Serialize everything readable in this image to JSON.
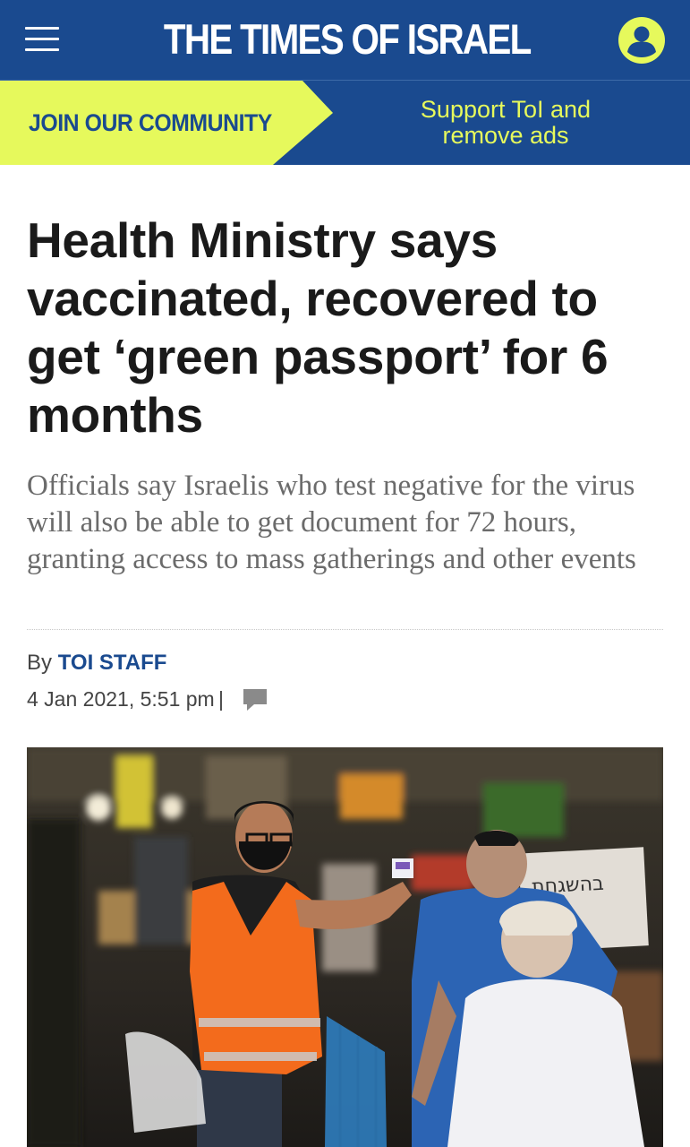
{
  "header": {
    "site_title": "THE TIMES OF ISRAEL",
    "menu_icon": "hamburger-menu-icon",
    "account_icon": "user-account-icon"
  },
  "banner": {
    "join_label": "JOIN OUR COMMUNITY",
    "support_label": "Support ToI and remove ads"
  },
  "article": {
    "headline": "Health Ministry says vaccinated, recovered to get ‘green passport’ for 6 months",
    "subheadline": "Officials say Israelis who test negative for the virus will also be able to get document for 72 hours, granting access to mass gatherings and other events",
    "byline_prefix": "By",
    "author": "TOI STAFF",
    "date": "4 Jan 2021, 5:51 pm",
    "separator": "|",
    "comment_icon": "comment-bubble-icon",
    "sign_text": "בהשגחת"
  },
  "colors": {
    "brand_blue": "#1a4a8f",
    "accent_yellow": "#e6f95c",
    "headline_text": "#1a1a1a",
    "subhead_text": "#6b6b6b"
  }
}
